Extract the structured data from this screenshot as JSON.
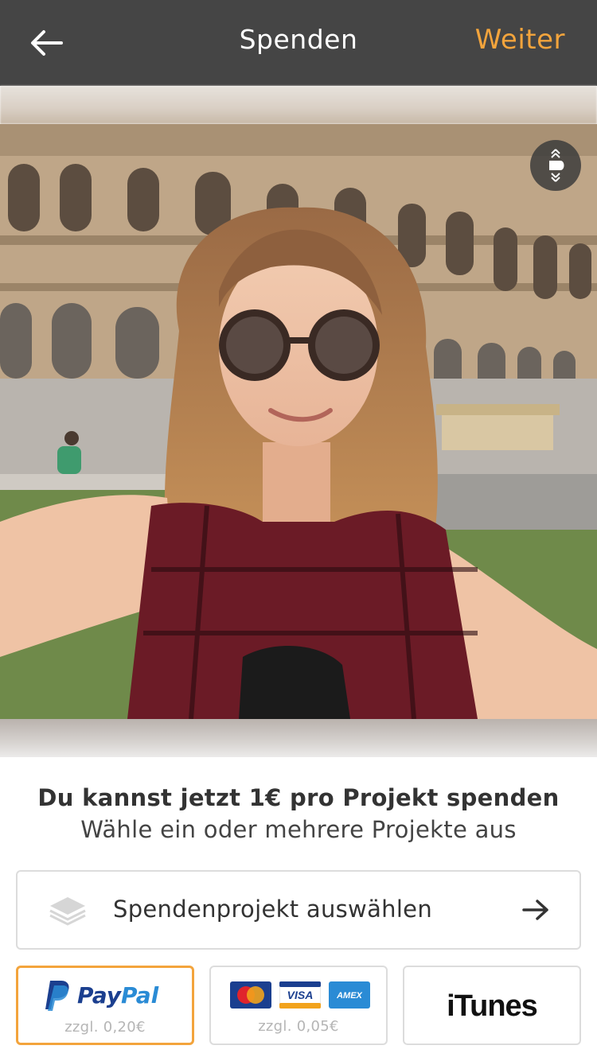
{
  "header": {
    "title": "Spenden",
    "next_label": "Weiter",
    "accent_color": "#f3a43c",
    "background_color": "#454545"
  },
  "photo": {
    "rotate_icon": "rotate-orientation-icon"
  },
  "content": {
    "headline": "Du kannst jetzt 1€ pro Projekt spenden",
    "subline": "Wähle ein oder mehrere Projekte aus"
  },
  "project_select": {
    "label": "Spendenprojekt auswählen",
    "icon": "layers-icon"
  },
  "payment_options": [
    {
      "name": "PayPal",
      "fee": "zzgl. 0,20€",
      "selected": true
    },
    {
      "name": "Kreditkarte",
      "logos": [
        "MasterCard",
        "VISA",
        "AMEX"
      ],
      "fee": "zzgl. 0,05€",
      "selected": false
    },
    {
      "name": "iTunes",
      "fee": "",
      "selected": false
    }
  ]
}
